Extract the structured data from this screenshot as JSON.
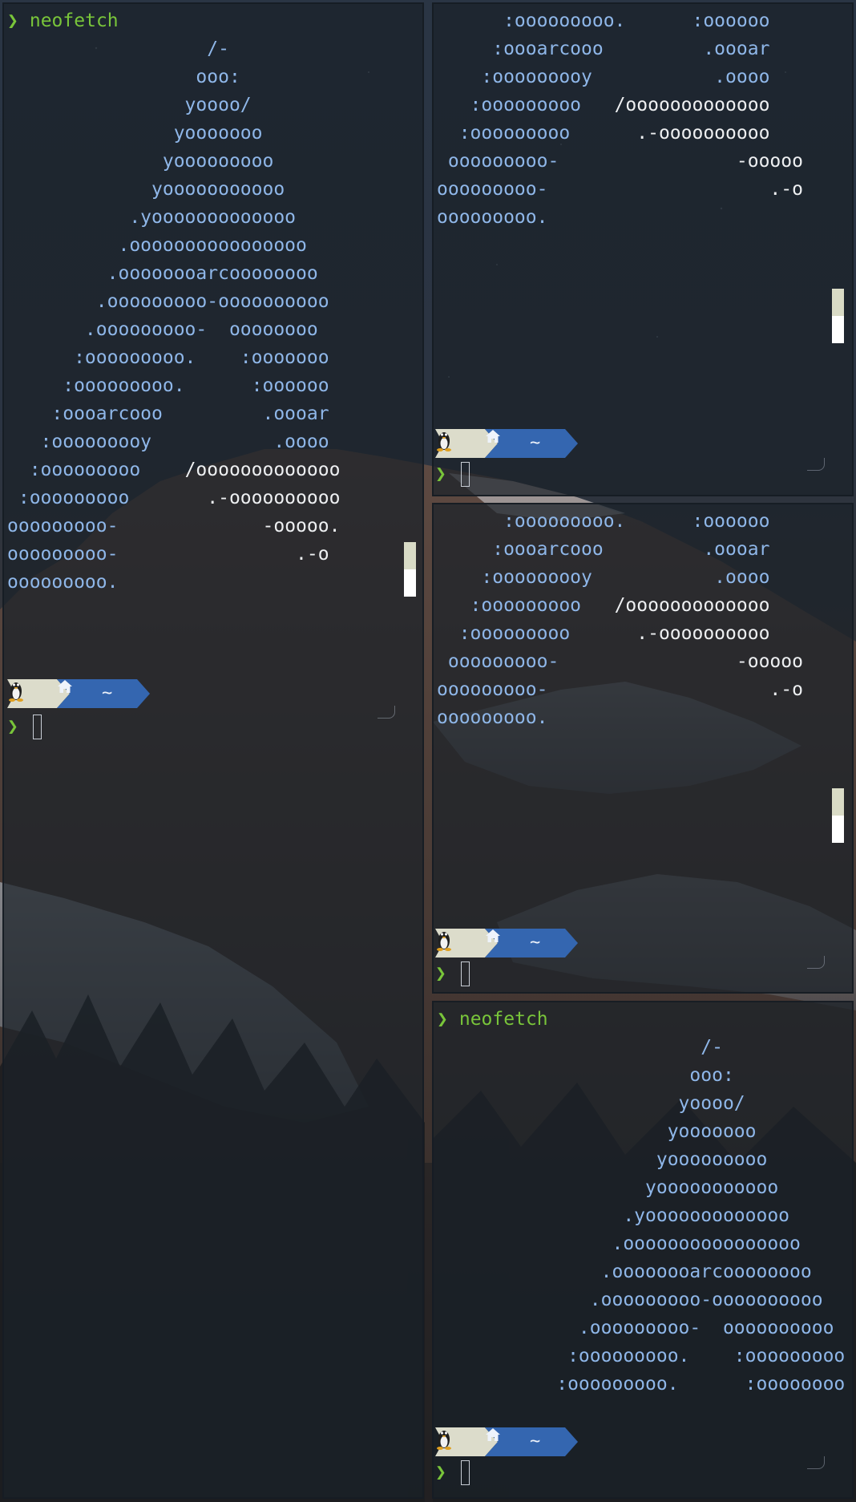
{
  "terminal": {
    "command_arrow": "❯",
    "command": "neofetch",
    "home_label": "~",
    "os_icon": "tux-icon",
    "home_icon": "home-icon",
    "colors": {
      "prompt_green": "#79c53a",
      "logo_blue": "#8fb7e9",
      "logo_white": "#eef0f2",
      "os_segment_bg": "#dcdccb",
      "home_segment_bg": "#3466b0"
    }
  },
  "panes": {
    "left": {
      "command": "neofetch",
      "art": [
        {
          "a": "                  /-",
          "b": ""
        },
        {
          "a": "                 ooo:",
          "b": ""
        },
        {
          "a": "                yoooo/",
          "b": ""
        },
        {
          "a": "               yooooooo",
          "b": ""
        },
        {
          "a": "              yooooooooo",
          "b": ""
        },
        {
          "a": "             yooooooooooo",
          "b": ""
        },
        {
          "a": "           .yooooooooooooo",
          "b": ""
        },
        {
          "a": "          .oooooooooooooooo",
          "b": ""
        },
        {
          "a": "         .oooooooarcoooooooo",
          "b": ""
        },
        {
          "a": "        .ooooooooo-oooooooooo",
          "b": ""
        },
        {
          "a": "       .ooooooooo-  oooooooo",
          "b": ""
        },
        {
          "a": "      :ooooooooo.    :ooooooo",
          "b": ""
        },
        {
          "a": "     :ooooooooo.      :oooooo",
          "b": ""
        },
        {
          "a": "    :oooarcooo         .oooar",
          "b": ""
        },
        {
          "a": "   :ooooooooy           .oooo",
          "b": ""
        },
        {
          "a": "  :ooooooooo    ",
          "b": "/ooooooooooooo"
        },
        {
          "a": " :ooooooooo       ",
          "b": ".-oooooooooo"
        },
        {
          "a": "ooooooooo-             ",
          "b": "-ooooo."
        },
        {
          "a": "ooooooooo-                ",
          "b": ".-o"
        },
        {
          "a": "ooooooooo.",
          "b": ""
        }
      ]
    },
    "top_right": {
      "art": [
        {
          "a": "      :ooooooooo.      :oooooo",
          "b": ""
        },
        {
          "a": "     :oooarcooo         .oooar",
          "b": ""
        },
        {
          "a": "    :ooooooooy           .oooo",
          "b": ""
        },
        {
          "a": "   :ooooooooo   ",
          "b": "/ooooooooooooo"
        },
        {
          "a": "  :ooooooooo      ",
          "b": ".-oooooooooo"
        },
        {
          "a": " ooooooooo-                ",
          "b": "-ooooo"
        },
        {
          "a": "ooooooooo-                    ",
          "b": ".-o"
        },
        {
          "a": "ooooooooo.",
          "b": ""
        }
      ]
    },
    "middle_right": {
      "art": [
        {
          "a": "      :ooooooooo.      :oooooo",
          "b": ""
        },
        {
          "a": "     :oooarcooo         .oooar",
          "b": ""
        },
        {
          "a": "    :ooooooooy           .oooo",
          "b": ""
        },
        {
          "a": "   :ooooooooo   ",
          "b": "/ooooooooooooo"
        },
        {
          "a": "  :ooooooooo      ",
          "b": ".-oooooooooo"
        },
        {
          "a": " ooooooooo-                ",
          "b": "-ooooo"
        },
        {
          "a": "ooooooooo-                    ",
          "b": ".-o"
        },
        {
          "a": "ooooooooo.",
          "b": ""
        }
      ]
    },
    "bottom_right": {
      "command": "neofetch",
      "art": [
        {
          "a": "                  /-",
          "b": ""
        },
        {
          "a": "                 ooo:",
          "b": ""
        },
        {
          "a": "                yoooo/",
          "b": ""
        },
        {
          "a": "               yooooooo",
          "b": ""
        },
        {
          "a": "              yooooooooo",
          "b": ""
        },
        {
          "a": "             yooooooooooo",
          "b": ""
        },
        {
          "a": "           .yooooooooooooo",
          "b": ""
        },
        {
          "a": "          .oooooooooooooooo",
          "b": ""
        },
        {
          "a": "         .oooooooarcoooooooo",
          "b": ""
        },
        {
          "a": "        .ooooooooo-oooooooooo",
          "b": ""
        },
        {
          "a": "       .ooooooooo-  oooooooooo",
          "b": ""
        },
        {
          "a": "      :ooooooooo.    :ooooooooo",
          "b": ""
        },
        {
          "a": "     :ooooooooo.      :oooooooo",
          "b": ""
        }
      ]
    }
  }
}
